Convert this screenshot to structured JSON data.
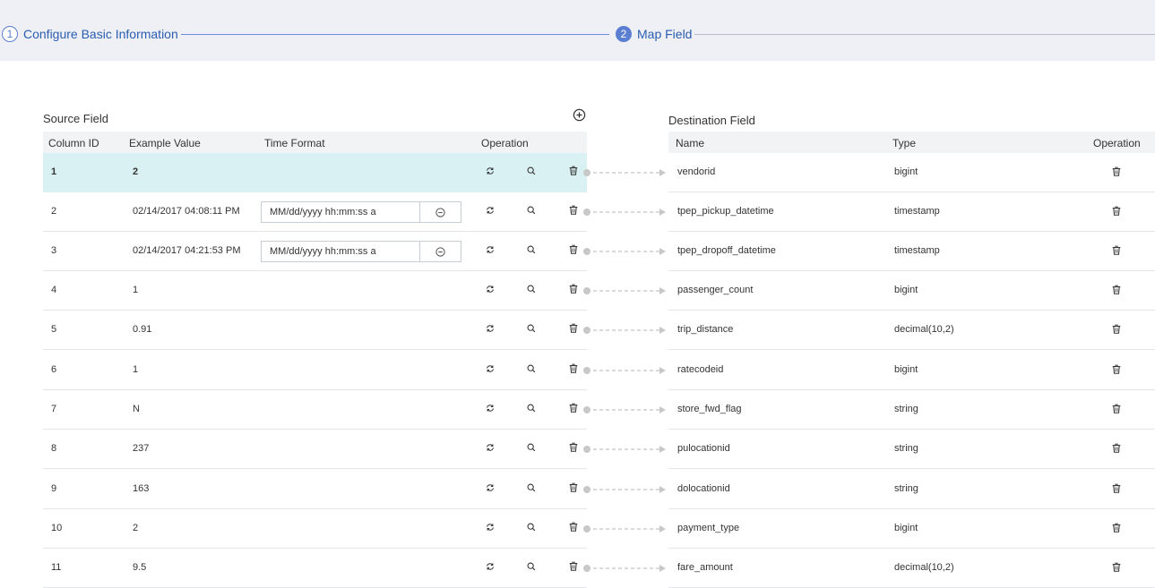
{
  "steps": [
    {
      "number": "1",
      "label": "Configure Basic Information"
    },
    {
      "number": "2",
      "label": "Map Field"
    }
  ],
  "source": {
    "title": "Source Field",
    "headers": {
      "column_id": "Column ID",
      "example_value": "Example Value",
      "time_format": "Time Format",
      "operation": "Operation"
    },
    "rows": [
      {
        "id": "1",
        "value": "2",
        "time_format": ""
      },
      {
        "id": "2",
        "value": "02/14/2017 04:08:11 PM",
        "time_format": "MM/dd/yyyy hh:mm:ss a"
      },
      {
        "id": "3",
        "value": "02/14/2017 04:21:53 PM",
        "time_format": "MM/dd/yyyy hh:mm:ss a"
      },
      {
        "id": "4",
        "value": "1",
        "time_format": ""
      },
      {
        "id": "5",
        "value": "0.91",
        "time_format": ""
      },
      {
        "id": "6",
        "value": "1",
        "time_format": ""
      },
      {
        "id": "7",
        "value": "N",
        "time_format": ""
      },
      {
        "id": "8",
        "value": "237",
        "time_format": ""
      },
      {
        "id": "9",
        "value": "163",
        "time_format": ""
      },
      {
        "id": "10",
        "value": "2",
        "time_format": ""
      },
      {
        "id": "11",
        "value": "9.5",
        "time_format": ""
      }
    ]
  },
  "destination": {
    "title": "Destination Field",
    "headers": {
      "name": "Name",
      "type": "Type",
      "operation": "Operation"
    },
    "rows": [
      {
        "name": "vendorid",
        "type": "bigint"
      },
      {
        "name": "tpep_pickup_datetime",
        "type": "timestamp"
      },
      {
        "name": "tpep_dropoff_datetime",
        "type": "timestamp"
      },
      {
        "name": "passenger_count",
        "type": "bigint"
      },
      {
        "name": "trip_distance",
        "type": "decimal(10,2)"
      },
      {
        "name": "ratecodeid",
        "type": "bigint"
      },
      {
        "name": "store_fwd_flag",
        "type": "string"
      },
      {
        "name": "pulocationid",
        "type": "string"
      },
      {
        "name": "dolocationid",
        "type": "string"
      },
      {
        "name": "payment_type",
        "type": "bigint"
      },
      {
        "name": "fare_amount",
        "type": "decimal(10,2)"
      }
    ]
  },
  "icons": {
    "add": "add-circle-icon",
    "convert": "convert-icon",
    "search": "search-icon",
    "delete": "trash-icon",
    "remove": "minus-circle-icon",
    "connector": "arrow-connector-icon"
  },
  "colors": {
    "accent": "#5b7fd0",
    "selected_row": "#d9f1f3",
    "header_bg": "#f2f3f5",
    "step_bg": "#eef0f5"
  }
}
